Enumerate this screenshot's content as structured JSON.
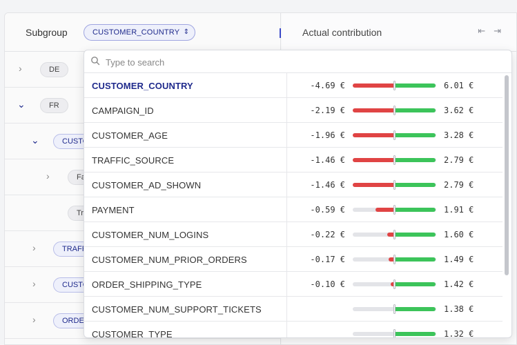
{
  "header": {
    "subgroup_label": "Subgroup",
    "subgroup_value": "CUSTOMER_COUNTRY",
    "actual_label": "Actual contribution"
  },
  "tree": [
    {
      "label": "DE",
      "expanded": false
    },
    {
      "label": "FR",
      "expanded": true
    },
    {
      "label": "CUSTOMER_COUNTRY",
      "expanded": true
    },
    {
      "label": "Fa",
      "expanded": false
    },
    {
      "label": "Tr",
      "expanded": false
    },
    {
      "label": "TRAFFIC_SOURCE",
      "expanded": false
    },
    {
      "label": "CUSTOMER_AGE",
      "expanded": false
    },
    {
      "label": "ORDER_SHIPPING_TYPE",
      "expanded": false
    }
  ],
  "search": {
    "placeholder": "Type to search"
  },
  "colors": {
    "accent": "#1f2a8c",
    "negative": "#e04444",
    "positive": "#3cc45a"
  },
  "items": [
    {
      "name": "CUSTOMER_COUNTRY",
      "neg": "-4.69 €",
      "pos": "6.01 €",
      "neg_frac": 1.0,
      "pos_frac": 1.0,
      "selected": true
    },
    {
      "name": "CAMPAIGN_ID",
      "neg": "-2.19 €",
      "pos": "3.62 €",
      "neg_frac": 1.0,
      "pos_frac": 1.0
    },
    {
      "name": "CUSTOMER_AGE",
      "neg": "-1.96 €",
      "pos": "3.28 €",
      "neg_frac": 1.0,
      "pos_frac": 1.0
    },
    {
      "name": "TRAFFIC_SOURCE",
      "neg": "-1.46 €",
      "pos": "2.79 €",
      "neg_frac": 1.0,
      "pos_frac": 1.0
    },
    {
      "name": "CUSTOMER_AD_SHOWN",
      "neg": "-1.46 €",
      "pos": "2.79 €",
      "neg_frac": 1.0,
      "pos_frac": 1.0
    },
    {
      "name": "PAYMENT",
      "neg": "-0.59 €",
      "pos": "1.91 €",
      "neg_frac": 0.45,
      "pos_frac": 1.0
    },
    {
      "name": "CUSTOMER_NUM_LOGINS",
      "neg": "-0.22 €",
      "pos": "1.60 €",
      "neg_frac": 0.17,
      "pos_frac": 1.0
    },
    {
      "name": "CUSTOMER_NUM_PRIOR_ORDERS",
      "neg": "-0.17 €",
      "pos": "1.49 €",
      "neg_frac": 0.13,
      "pos_frac": 1.0
    },
    {
      "name": "ORDER_SHIPPING_TYPE",
      "neg": "-0.10 €",
      "pos": "1.42 €",
      "neg_frac": 0.08,
      "pos_frac": 1.0
    },
    {
      "name": "CUSTOMER_NUM_SUPPORT_TICKETS",
      "neg": "",
      "pos": "1.38 €",
      "neg_frac": 0,
      "pos_frac": 1.0
    },
    {
      "name": "CUSTOMER_TYPE",
      "neg": "",
      "pos": "1.32 €",
      "neg_frac": 0,
      "pos_frac": 1.0
    }
  ]
}
